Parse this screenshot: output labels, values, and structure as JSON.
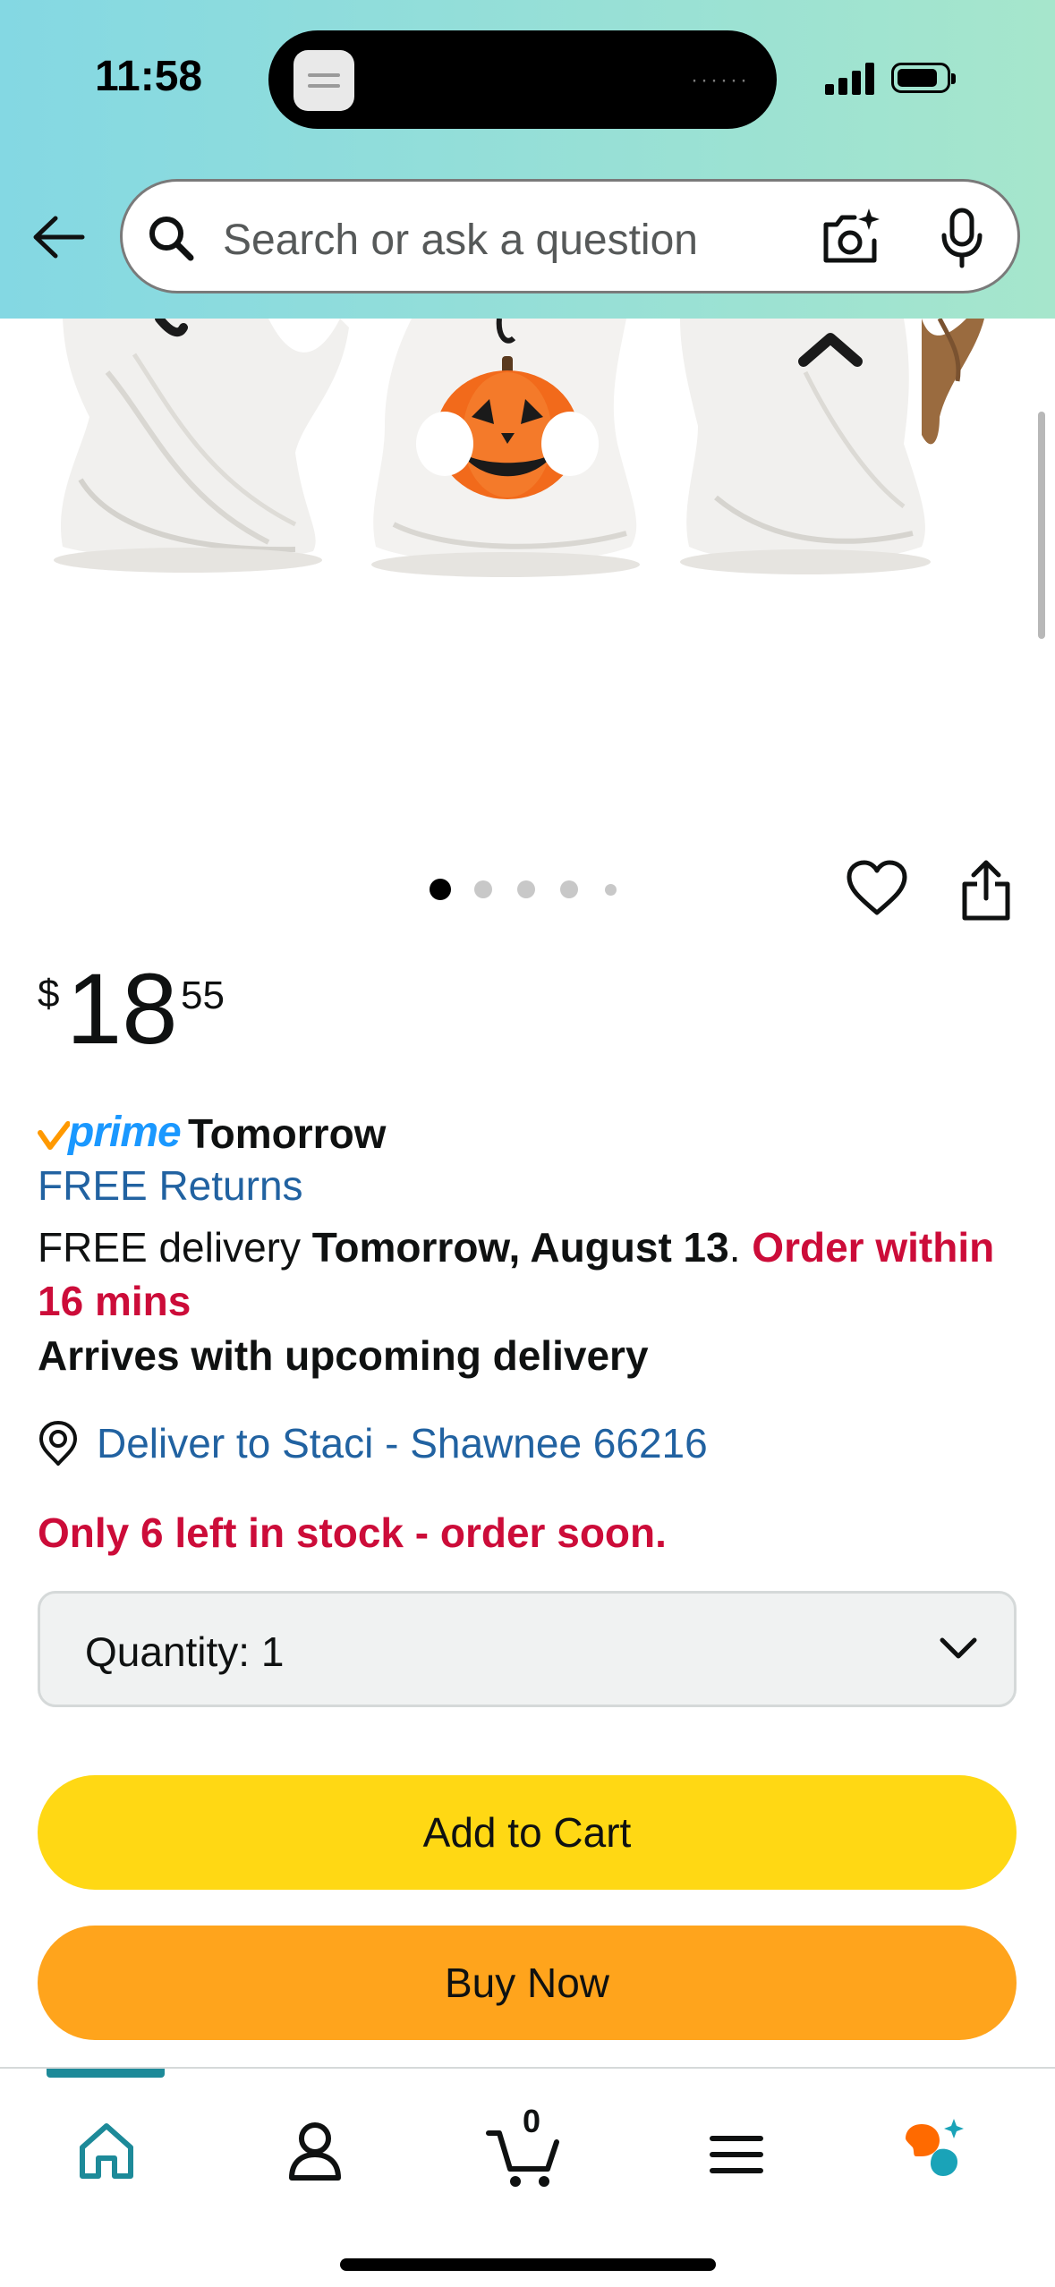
{
  "status_bar": {
    "time": "11:58"
  },
  "search": {
    "placeholder": "Search or ask a question"
  },
  "carousel": {
    "total_images": 5,
    "active_index": 0
  },
  "price": {
    "symbol": "$",
    "whole": "18",
    "fraction": "55"
  },
  "delivery": {
    "prime_label": "prime",
    "prime_day": "Tomorrow",
    "free_returns": "FREE Returns",
    "free_delivery_prefix": "FREE delivery ",
    "delivery_date": "Tomorrow, August 13",
    "period": ". ",
    "order_within": "Order within 16 mins",
    "arrives_note": "Arrives with upcoming delivery",
    "location": "Deliver to Staci - Shawnee 66216"
  },
  "stock": {
    "message": "Only 6 left in stock - order soon."
  },
  "quantity": {
    "label": "Quantity:",
    "value": "1"
  },
  "buttons": {
    "add_to_cart": "Add to Cart",
    "buy_now": "Buy Now"
  },
  "bottom_nav": {
    "active": "home",
    "cart_count": "0",
    "items": [
      "home-icon",
      "account-icon",
      "cart-icon",
      "menu-icon",
      "rufus-icon"
    ]
  },
  "colors": {
    "header_gradient_start": "#84d8e3",
    "header_gradient_end": "#a6e6cc",
    "link_blue": "#2162a1",
    "urgent_red": "#cc0c39",
    "prime_blue": "#1a98ff",
    "add_to_cart_yellow": "#ffd814",
    "buy_now_orange": "#ffa41c",
    "nav_active_teal": "#1d8a99"
  }
}
